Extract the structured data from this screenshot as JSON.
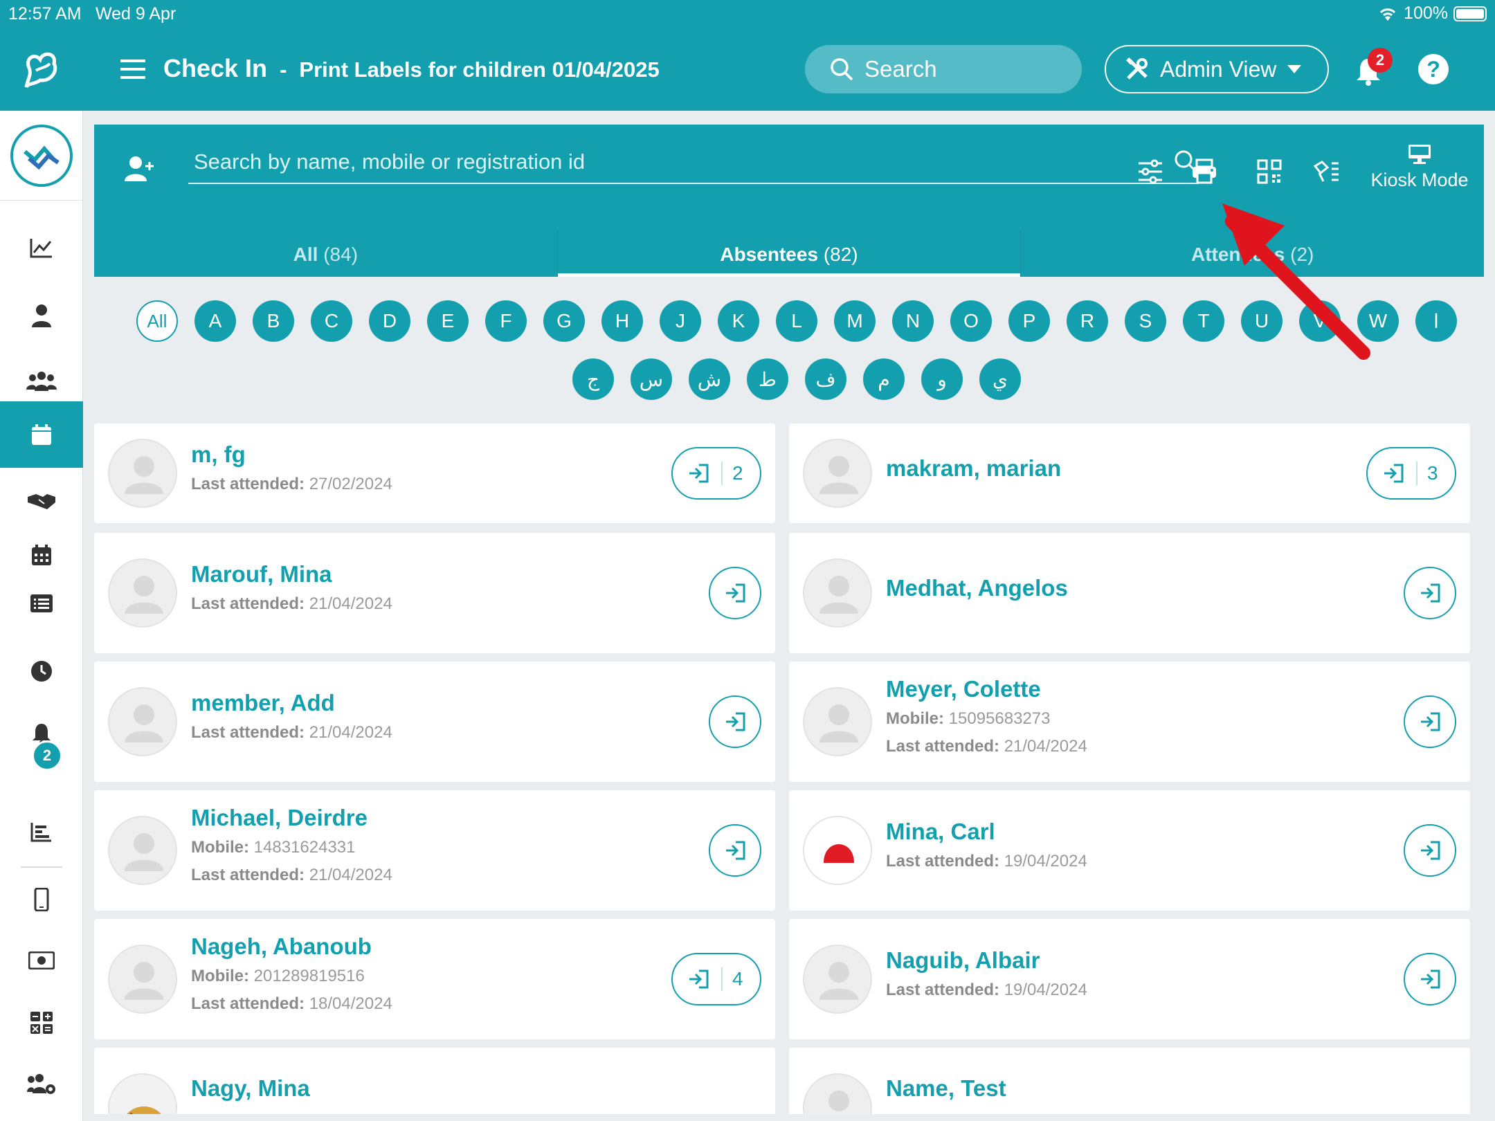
{
  "status": {
    "time": "12:57 AM",
    "date": "Wed 9 Apr",
    "battery": "100%"
  },
  "header": {
    "title": "Check In",
    "dash": "-",
    "subtitle": "Print Labels for children 01/04/2025",
    "search_label": "Search",
    "admin_label": "Admin View",
    "notifications": "2",
    "help": "?"
  },
  "sidebar": {
    "notifications_badge": "2"
  },
  "panel": {
    "search_placeholder": "Search by name, mobile or registration id",
    "kiosk_label": "Kiosk Mode"
  },
  "tabs": [
    {
      "label": "All",
      "count": "(84)"
    },
    {
      "label": "Absentees",
      "count": "(82)"
    },
    {
      "label": "Attendees",
      "count": "(2)"
    }
  ],
  "letters_row1": [
    "All",
    "A",
    "B",
    "C",
    "D",
    "E",
    "F",
    "G",
    "H",
    "J",
    "K",
    "L",
    "M",
    "N",
    "O",
    "P",
    "R",
    "S",
    "T",
    "U",
    "V",
    "W",
    "ا"
  ],
  "letters_row2": [
    "ج",
    "س",
    "ش",
    "ط",
    "ف",
    "م",
    "و",
    "ي"
  ],
  "field_labels": {
    "last_attended": "Last attended:",
    "mobile": "Mobile:"
  },
  "members": [
    {
      "name": "m, fg",
      "last_attended": "27/02/2024",
      "checkins": "2"
    },
    {
      "name": "makram, marian",
      "checkins": "3"
    },
    {
      "name": "Marouf, Mina",
      "last_attended": "21/04/2024"
    },
    {
      "name": "Medhat, Angelos"
    },
    {
      "name": "member, Add",
      "last_attended": "21/04/2024"
    },
    {
      "name": "Meyer, Colette",
      "mobile": "15095683273",
      "last_attended": "21/04/2024"
    },
    {
      "name": "Michael, Deirdre",
      "mobile": "14831624331",
      "last_attended": "21/04/2024"
    },
    {
      "name": "Mina, Carl",
      "last_attended": "19/04/2024"
    },
    {
      "name": "Nageh, Abanoub",
      "mobile": "201289819516",
      "last_attended": "18/04/2024",
      "checkins": "4"
    },
    {
      "name": "Naguib, Albair",
      "last_attended": "19/04/2024"
    },
    {
      "name": "Nagy, Mina"
    },
    {
      "name": "Name, Test"
    }
  ],
  "colors": {
    "primary": "#149faf",
    "badge": "#e3202a",
    "annotation_arrow": "#e0141c"
  }
}
